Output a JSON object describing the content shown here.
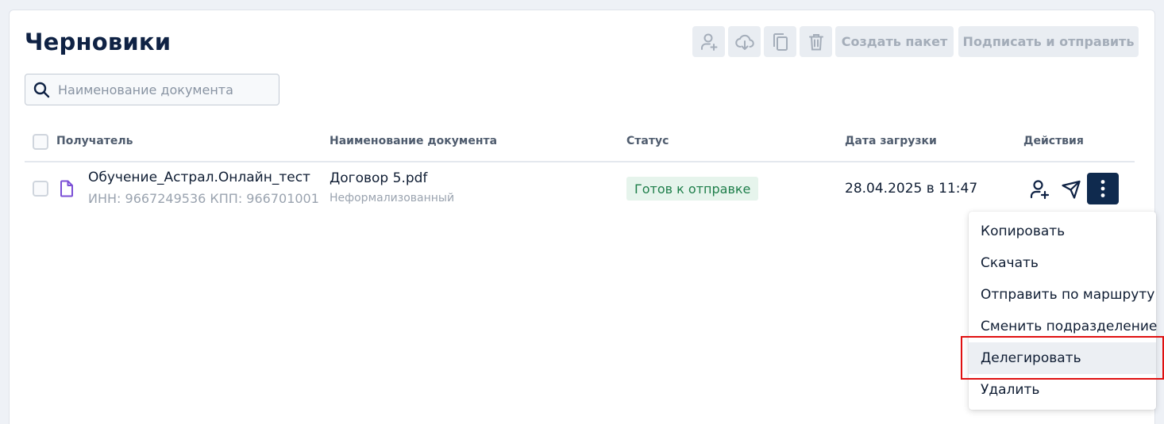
{
  "page": {
    "title": "Черновики"
  },
  "toolbar": {
    "icons": [
      "add-recipient-icon",
      "cloud-download-icon",
      "copy-icon",
      "trash-icon"
    ],
    "create_package_label": "Создать пакет",
    "sign_and_send_label": "Подписать и отправить"
  },
  "search": {
    "placeholder": "Наименование документа",
    "value": ""
  },
  "table": {
    "headers": {
      "recipient": "Получатель",
      "document": "Наименование документа",
      "status": "Статус",
      "upload_date": "Дата загрузки",
      "actions": "Действия"
    },
    "rows": [
      {
        "recipient_name": "Обучение_Астрал.Онлайн_тест",
        "recipient_ids": "ИНН: 9667249536 КПП: 966701001",
        "document_name": "Договор 5.pdf",
        "document_type": "Неформализованный",
        "status": "Готов к отправке",
        "upload_date": "28.04.2025 в 11:47"
      }
    ]
  },
  "menu": {
    "items": [
      {
        "label": "Копировать"
      },
      {
        "label": "Скачать"
      },
      {
        "label": "Отправить по маршруту"
      },
      {
        "label": "Сменить подразделение"
      },
      {
        "label": "Делегировать"
      },
      {
        "label": "Удалить"
      }
    ],
    "highlighted_index": 4
  },
  "colors": {
    "primary": "#0f2a4e",
    "status_bg": "#e6f4ec",
    "status_text": "#1e7e4a",
    "highlight_border": "#e01010",
    "doc_icon": "#7b4fd6"
  }
}
